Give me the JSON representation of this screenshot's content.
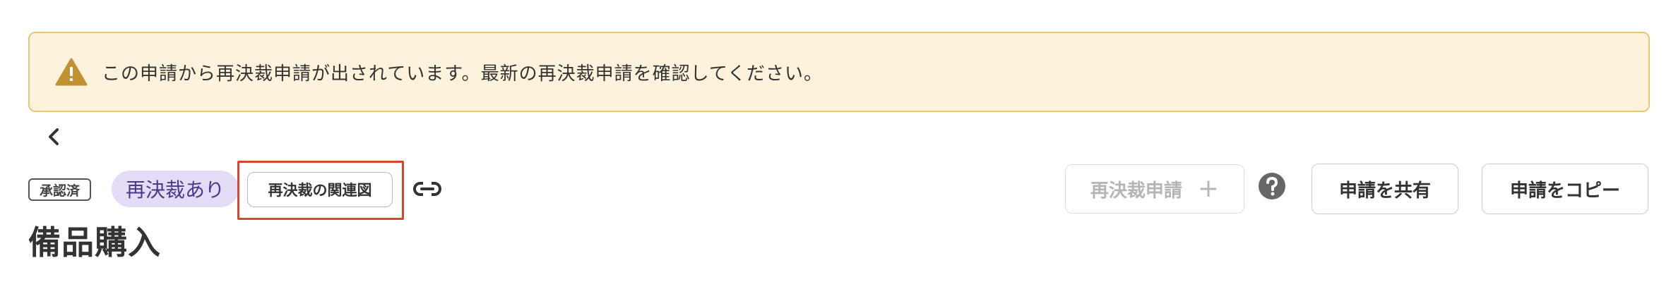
{
  "alert": {
    "icon": "warning-triangle-icon",
    "color": "#c09233",
    "message": "この申請から再決裁申請が出されています。最新の再決裁申請を確認してください。"
  },
  "nav": {
    "back_icon": "chevron-left-icon"
  },
  "status": {
    "approved_label": "承認済",
    "reapply_badge": "再決裁あり",
    "reapply_badge_color": "#e4dcf7"
  },
  "actions": {
    "related_label": "再決裁の関連図",
    "link_icon": "link-icon",
    "reapply_label": "再決裁申請",
    "reapply_plus": "+",
    "help_icon": "question-circle-icon",
    "share_label": "申請を共有",
    "copy_label": "申請をコピー"
  },
  "page": {
    "title": "備品購入"
  }
}
